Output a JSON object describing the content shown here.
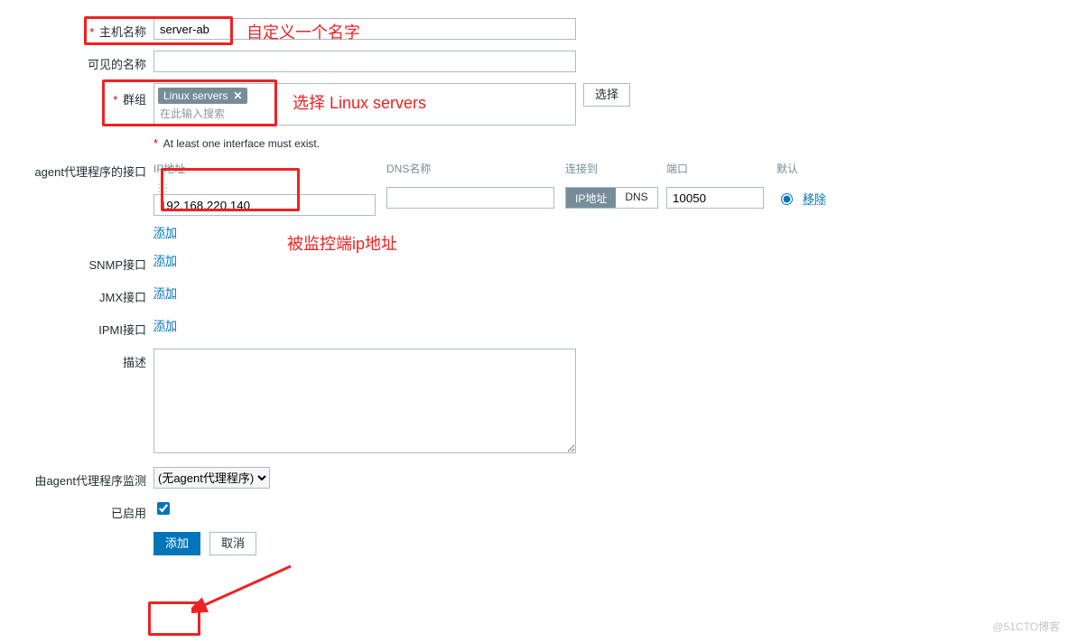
{
  "labels": {
    "host_name": "主机名称",
    "visible_name": "可见的名称",
    "groups": "群组",
    "note_interface": "At least one interface must exist.",
    "agent_iface": "agent代理程序的接口",
    "snmp_iface": "SNMP接口",
    "jmx_iface": "JMX接口",
    "ipmi_iface": "IPMI接口",
    "description": "描述",
    "monitored_by": "由agent代理程序监测",
    "enabled": "已启用"
  },
  "values": {
    "host_name": "server-ab",
    "visible_name": "",
    "group_tag": "Linux servers",
    "groups_placeholder": "在此输入搜索",
    "ip": "192.168.220.140",
    "dns": "",
    "port": "10050",
    "description": "",
    "proxy_option": "(无agent代理程序)",
    "enabled_checked": true
  },
  "headers": {
    "ip": "IP地址",
    "dns": "DNS名称",
    "connect": "连接到",
    "port": "端口",
    "default": "默认"
  },
  "seg": {
    "ip": "IP地址",
    "dns": "DNS"
  },
  "buttons": {
    "select": "选择",
    "add_link": "添加",
    "remove": "移除",
    "submit_add": "添加",
    "cancel": "取消"
  },
  "annotations": {
    "a1": "自定义一个名字",
    "a2": "选择 Linux servers",
    "a3": "被监控端ip地址"
  },
  "watermark": "@51CTO博客"
}
